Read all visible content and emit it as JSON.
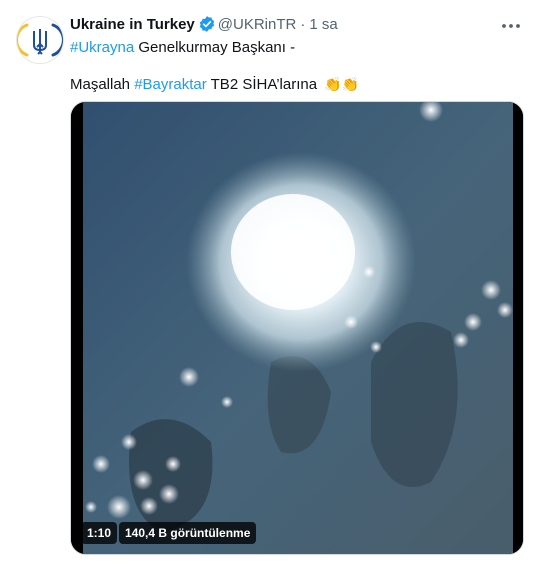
{
  "tweet": {
    "author_name": "Ukraine in Turkey",
    "handle": "@UKRinTR",
    "separator": "·",
    "time": "1 sa",
    "line1_hashtag": "#Ukrayna",
    "line1_text": " Genelkurmay Başkanı -",
    "line2_prefix": "Maşallah ",
    "line2_hashtag": "#Bayraktar",
    "line2_text": " TB2 SİHA’larına ",
    "line2_emoji": "👏👏",
    "icons": {
      "avatar": "ukraine-trident-logo-icon",
      "verified": "verified-badge-icon",
      "more": "more-options-icon"
    }
  },
  "video": {
    "duration": "1:10",
    "views": "140,4 B görüntülenme"
  },
  "colors": {
    "accent": "#1d9bf0",
    "secondary_text": "#536471",
    "primary_text": "#0f1419",
    "trident_blue": "#1f4e9c",
    "trident_yellow": "#f2c12e"
  }
}
